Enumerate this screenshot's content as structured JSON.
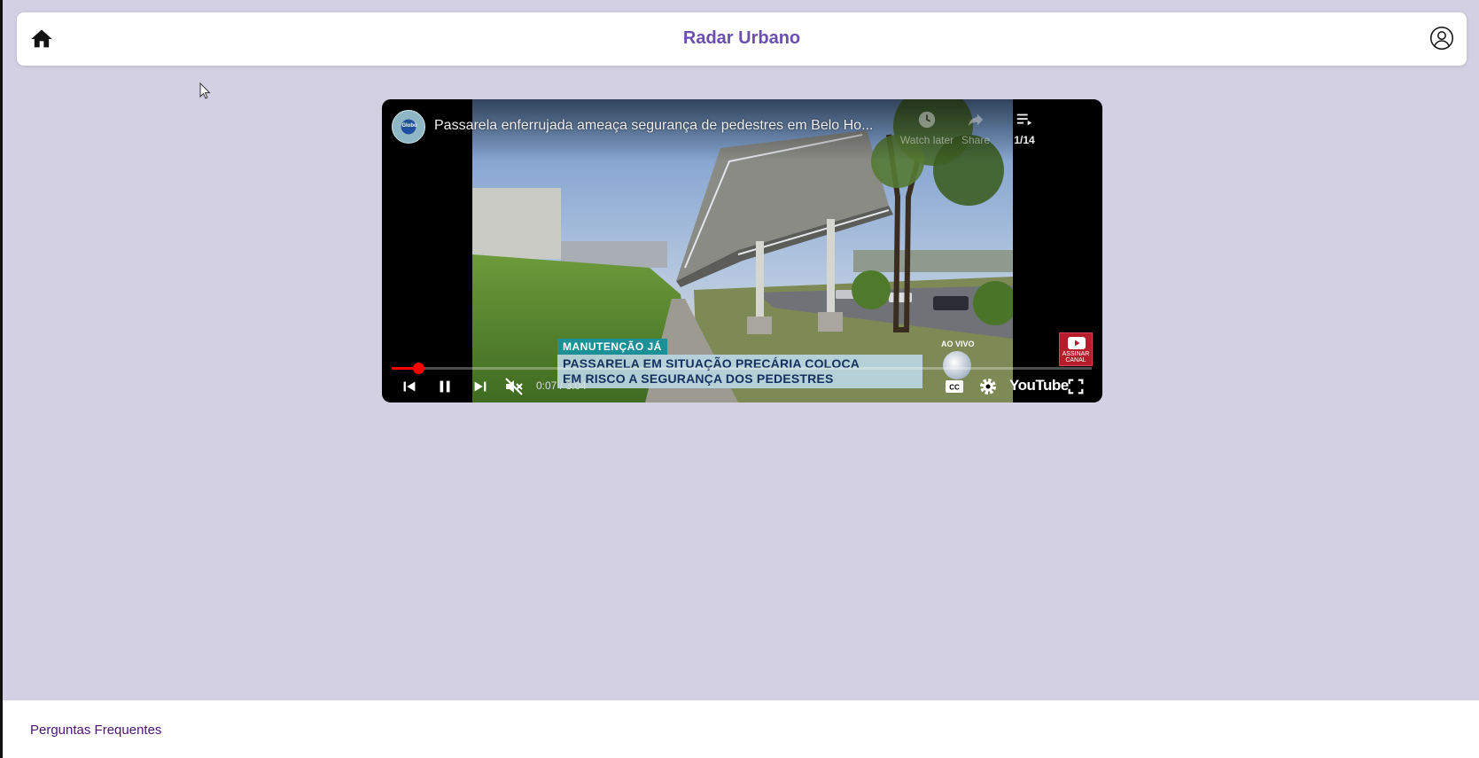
{
  "header": {
    "title": "Radar Urbano",
    "home_icon": "home-icon",
    "user_icon": "user-circle-icon"
  },
  "video": {
    "channel_avatar_text": "Globo",
    "title": "Passarela enferrujada ameaça segurança de pedestres em Belo Ho...",
    "watch_later_label": "Watch later",
    "share_label": "Share",
    "playlist_position": "1/14",
    "lower_third_tag": "MANUTENÇÃO JÁ",
    "lower_third_line1": "PASSARELA EM SITUAÇÃO PRECÁRIA COLOCA",
    "lower_third_line2": "EM RISCO A SEGURANÇA DOS PEDESTRES",
    "live_label": "AO VIVO",
    "subscribe_label_1": "ASSINAR",
    "subscribe_label_2": "CANAL",
    "time_display": "0:07 / 3:04",
    "progress_fraction": 0.038,
    "logo_text": "YouTube"
  },
  "footer": {
    "faq_label": "Perguntas Frequentes"
  },
  "colors": {
    "page_bg": "#d4d0e4",
    "title": "#6a4fb0",
    "faq_link": "#4b1472",
    "progress": "#ff0000"
  }
}
